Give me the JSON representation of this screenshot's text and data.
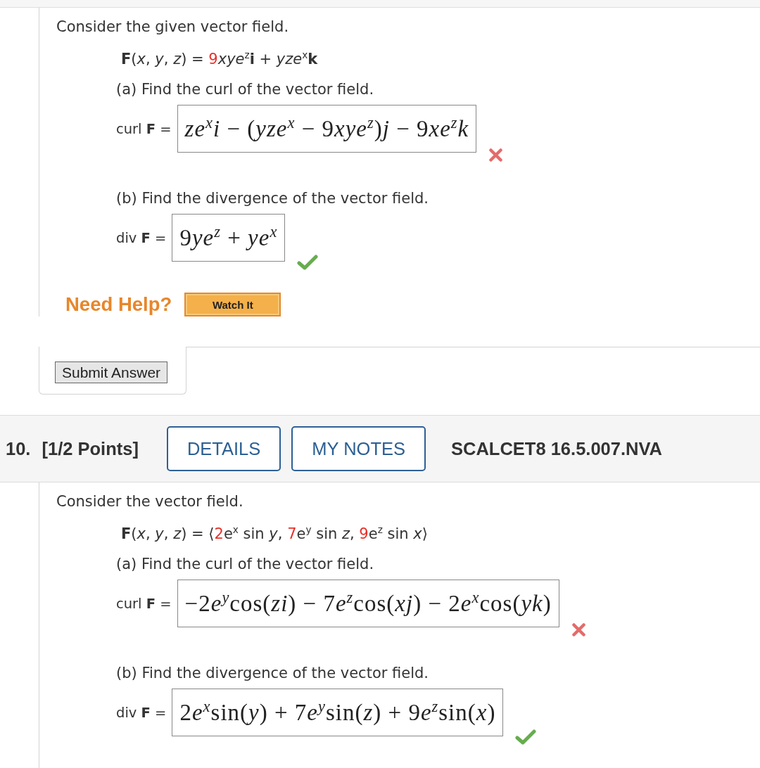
{
  "questions": [
    {
      "intro": "Consider the given vector field.",
      "formula": [
        {
          "text": "**F**(*x*, *y*, *z*) = ",
          "highlighted": false
        },
        {
          "text": "9",
          "highlighted": true
        },
        {
          "text": "*xye*$^{z}$**i** + *yze*$^{x}$**k**",
          "highlighted": false
        }
      ],
      "parts": [
        {
          "prompt": "(a) Find the curl of the vector field.",
          "label": "curl **F** =",
          "answer": [
            "*ze*$^{x}$*i* − (*yze*$^{x}$ − 9",
            "*xye*$^{z}$)*j* − 9",
            "*xe*$^{z}$*k*"
          ],
          "correct": false
        },
        {
          "prompt": "(b) Find the divergence of the vector field.",
          "label": "div **F** =",
          "answer": [
            "9",
            "*ye*$^{z}$ + *ye*$^{x}$"
          ],
          "correct": true
        }
      ],
      "help": {
        "label": "Need Help?",
        "buttons": [
          "Watch It"
        ]
      },
      "submit_button": "Submit Answer"
    },
    {
      "header": {
        "number": "10.",
        "points": "[1/2 Points]",
        "buttons": [
          "DETAILS",
          "MY NOTES"
        ],
        "code": "SCALCET8 16.5.007.NVA"
      },
      "intro": "Consider the vector field.",
      "formula": [
        {
          "text": "**F**(*x*, *y*, *z*) = ⟨",
          "highlighted": false
        },
        {
          "text": "2",
          "highlighted": true
        },
        {
          "text": "e$^{x}$ sin *y*, ",
          "highlighted": false
        },
        {
          "text": "7",
          "highlighted": true
        },
        {
          "text": "e$^{y}$ sin *z*, ",
          "highlighted": false
        },
        {
          "text": "9",
          "highlighted": true
        },
        {
          "text": "e$^{z}$ sin *x*⟩",
          "highlighted": false
        }
      ],
      "parts": [
        {
          "prompt": "(a) Find the curl of the vector field.",
          "label": "curl **F** =",
          "answer": [
            "−2",
            "*e*$^{y}$cos(*zi*) − 7",
            "*e*$^{z}$cos(*xj*) − 2",
            "*e*$^{x}$cos(*yk*)"
          ],
          "correct": false
        },
        {
          "prompt": "(b) Find the divergence of the vector field.",
          "label": "div **F** =",
          "answer": [
            "2",
            "*e*$^{x}$sin(*y*) + 7",
            "*e*$^{y}$sin(*z*) + 9",
            "*e*$^{z}$sin(*x*)"
          ],
          "correct": true
        }
      ]
    }
  ]
}
